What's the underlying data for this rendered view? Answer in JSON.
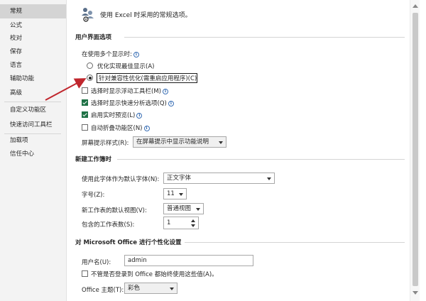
{
  "sidebar": {
    "items": [
      {
        "label": "常规",
        "selected": true
      },
      {
        "label": "公式"
      },
      {
        "label": "校对"
      },
      {
        "label": "保存"
      },
      {
        "label": "语言"
      },
      {
        "label": "辅助功能"
      },
      {
        "label": "高级"
      },
      {
        "label": "自定义功能区"
      },
      {
        "label": "快速访问工具栏"
      },
      {
        "label": "加载项"
      },
      {
        "label": "信任中心"
      }
    ]
  },
  "intro": {
    "text": "使用 Excel 时采用的常规选项。",
    "icon": "settings-people-icon"
  },
  "ui_options": {
    "title": "用户界面选项",
    "multi_display_label": "在使用多个显示时:",
    "radio_best_appearance": "优化实现最佳显示(A)",
    "radio_compatibility": "针对兼容性优化(需重启应用程序)(C)",
    "chk_mini_toolbar": "选择时显示浮动工具栏(M)",
    "chk_quick_analysis": "选择时显示快速分析选项(Q)",
    "chk_live_preview": "启用实时预览(L)",
    "chk_collapse_ribbon": "自动折叠功能区(N)",
    "screentip_label": "屏幕提示样式(R):",
    "screentip_value": "在屏幕提示中显示功能说明"
  },
  "new_workbook": {
    "title": "新建工作簿时",
    "font_label": "使用此字体作为默认字体(N):",
    "font_value": "正文字体",
    "size_label": "字号(Z):",
    "size_value": "11",
    "view_label": "新工作表的默认视图(V):",
    "view_value": "普通视图",
    "sheets_label": "包含的工作表数(S):",
    "sheets_value": "1"
  },
  "personalize": {
    "title": "对 Microsoft Office 进行个性化设置",
    "username_label": "用户名(U):",
    "username_value": "admin",
    "always_use_label": "不管是否登录到 Office 都始终使用这些值(A)。",
    "theme_label": "Office 主题(T):",
    "theme_value": "彩色"
  },
  "colors": {
    "annotation_arrow": "#c0262d",
    "checked_box": "#1e7145",
    "info_icon": "#3a6fb5"
  }
}
